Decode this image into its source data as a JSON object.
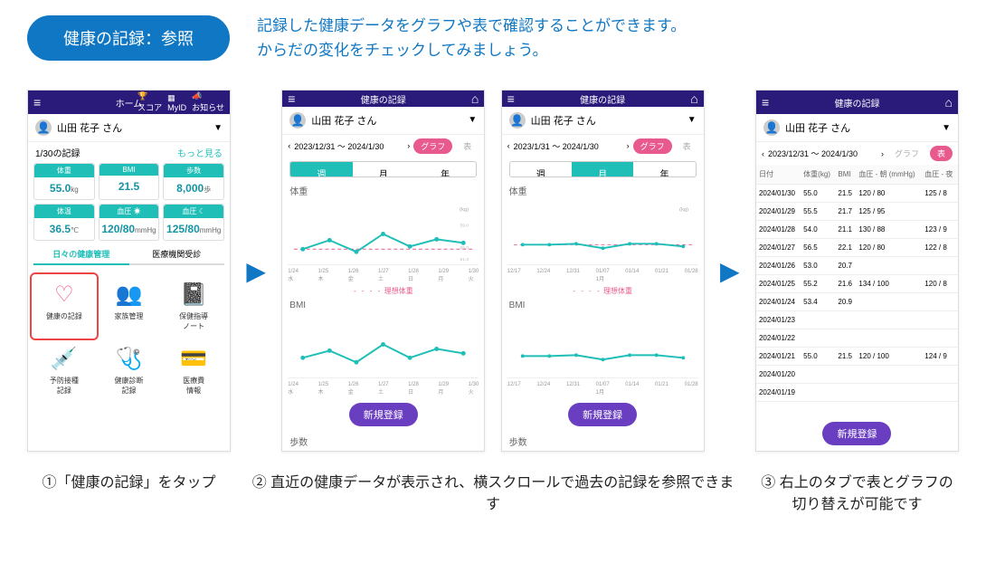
{
  "header": {
    "title": "健康の記録：参照",
    "intro_line1": "記録した健康データをグラフや表で確認することができます。",
    "intro_line2": "からだの変化をチェックしてみましょう。"
  },
  "user": {
    "name": "山田 花子 さん"
  },
  "phone1": {
    "app_title": "ホーム",
    "icons": {
      "score": "スコア",
      "myid": "MyID",
      "news": "お知らせ"
    },
    "record_date": "1/30の記録",
    "more": "もっと見る",
    "metrics_row1": [
      {
        "label": "体重",
        "value": "55.0",
        "unit": "kg"
      },
      {
        "label": "BMI",
        "value": "21.5",
        "unit": ""
      },
      {
        "label": "歩数",
        "value": "8,000",
        "unit": "歩"
      }
    ],
    "metrics_row2": [
      {
        "label": "体温",
        "value": "36.5",
        "unit": "℃"
      },
      {
        "label": "血圧 ☀",
        "value": "120/80",
        "unit": "mmHg"
      },
      {
        "label": "血圧 ☾",
        "value": "125/80",
        "unit": "mmHg"
      }
    ],
    "tabs": {
      "left": "日々の健康管理",
      "right": "医療機関受診"
    },
    "grid": [
      {
        "name": "health-record",
        "glyph": "♡",
        "cls": "pink",
        "label": "健康の記録",
        "hl": true
      },
      {
        "name": "family",
        "glyph": "👥",
        "cls": "pink",
        "label": "家族管理"
      },
      {
        "name": "guidance-note",
        "glyph": "📓",
        "cls": "purple",
        "label": "保健指導\nノート"
      },
      {
        "name": "vaccine",
        "glyph": "💉",
        "cls": "pink",
        "label": "予防接種\n記録"
      },
      {
        "name": "checkup",
        "glyph": "🩺",
        "cls": "red",
        "label": "健康診断\n記録"
      },
      {
        "name": "medical-cost",
        "glyph": "💳",
        "cls": "pink",
        "label": "医療費\n情報"
      }
    ]
  },
  "phone2": {
    "app_title": "健康の記録",
    "range": "2023/12/31 ～ 2024/1/30",
    "tabs": {
      "graph": "グラフ",
      "table": "表"
    },
    "seg": [
      "週",
      "月",
      "年"
    ],
    "seg_active": "週",
    "sections": {
      "w": "体重",
      "bmi": "BMI",
      "steps": "歩数"
    },
    "legend": "理想体重",
    "x_week": [
      "1/24\n水",
      "1/25\n木",
      "1/26\n金",
      "1/27\n土",
      "1/28\n日",
      "1/29\n月",
      "1/30\n火"
    ]
  },
  "phone3": {
    "app_title": "健康の記録",
    "range": "2023/1/31 ～ 2024/1/30",
    "tabs": {
      "graph": "グラフ",
      "table": "表"
    },
    "seg": [
      "週",
      "月",
      "年"
    ],
    "seg_active": "月",
    "sections": {
      "w": "体重",
      "bmi": "BMI",
      "steps": "歩数"
    },
    "legend": "理想体重",
    "x_month": [
      "12/17",
      "12/24",
      "12/31",
      "01/07\n1月",
      "01/14",
      "01/21",
      "01/28"
    ]
  },
  "phone4": {
    "app_title": "健康の記録",
    "range": "2023/12/31 ～ 2024/1/30",
    "tabs": {
      "graph": "グラフ",
      "table": "表"
    },
    "cols": [
      "日付",
      "体重(kg)",
      "BMI",
      "血圧 - 朝 (mmHg)",
      "血圧 - 夜"
    ],
    "rows": [
      [
        "2024/01/30",
        "55.0",
        "21.5",
        "120 / 80",
        "125 / 8"
      ],
      [
        "2024/01/29",
        "55.5",
        "21.7",
        "125 / 95",
        ""
      ],
      [
        "2024/01/28",
        "54.0",
        "21.1",
        "130 / 88",
        "123 / 9"
      ],
      [
        "2024/01/27",
        "56.5",
        "22.1",
        "120 / 80",
        "122 / 8"
      ],
      [
        "2024/01/26",
        "53.0",
        "20.7",
        "",
        ""
      ],
      [
        "2024/01/25",
        "55.2",
        "21.6",
        "134 / 100",
        "120 / 8"
      ],
      [
        "2024/01/24",
        "53.4",
        "20.9",
        "",
        ""
      ],
      [
        "2024/01/23",
        "",
        "",
        "",
        ""
      ],
      [
        "2024/01/22",
        "",
        "",
        "",
        ""
      ],
      [
        "2024/01/21",
        "55.0",
        "21.5",
        "120 / 100",
        "124 / 9"
      ],
      [
        "2024/01/20",
        "",
        "",
        "",
        ""
      ],
      [
        "2024/01/19",
        "",
        "",
        "",
        ""
      ]
    ]
  },
  "register_label": "新規登録",
  "captions": {
    "c1": "①「健康の記録」をタップ",
    "c2": "② 直近の健康データが表示され、横スクロールで過去の記録を参照できます",
    "c3": "③ 右上のタブで表とグラフの切り替えが可能です"
  },
  "chart_data": [
    {
      "type": "line",
      "title": "体重 — 週",
      "categories": [
        "1/24",
        "1/25",
        "1/26",
        "1/27",
        "1/28",
        "1/29",
        "1/30"
      ],
      "series": [
        {
          "name": "体重",
          "values": [
            53.4,
            55.2,
            53.0,
            56.5,
            54.0,
            55.5,
            55.0
          ]
        }
      ],
      "reference": {
        "name": "理想体重",
        "value": 55
      },
      "ylim": [
        50,
        63
      ],
      "ylabel": "(kg)"
    },
    {
      "type": "line",
      "title": "BMI — 週",
      "categories": [
        "1/24",
        "1/25",
        "1/26",
        "1/27",
        "1/28",
        "1/29",
        "1/30"
      ],
      "series": [
        {
          "name": "BMI",
          "values": [
            20.9,
            21.6,
            20.7,
            22.1,
            21.1,
            21.7,
            21.5
          ]
        }
      ],
      "ylim": [
        19,
        24
      ]
    },
    {
      "type": "line",
      "title": "体重 — 月",
      "categories": [
        "12/17",
        "12/24",
        "12/31",
        "01/07",
        "01/14",
        "01/21",
        "01/28"
      ],
      "series": [
        {
          "name": "体重",
          "values": [
            55,
            55,
            55,
            54,
            55,
            55,
            54
          ]
        }
      ],
      "reference": {
        "name": "理想体重",
        "value": 55
      },
      "ylim": [
        50,
        63
      ],
      "ylabel": "(kg)"
    },
    {
      "type": "line",
      "title": "BMI — 月",
      "categories": [
        "12/17",
        "12/24",
        "12/31",
        "01/07",
        "01/14",
        "01/21",
        "01/28"
      ],
      "series": [
        {
          "name": "BMI",
          "values": [
            21.5,
            21.5,
            21.5,
            21.1,
            21.5,
            21.5,
            21.1
          ]
        }
      ],
      "ylim": [
        19,
        24
      ]
    }
  ]
}
